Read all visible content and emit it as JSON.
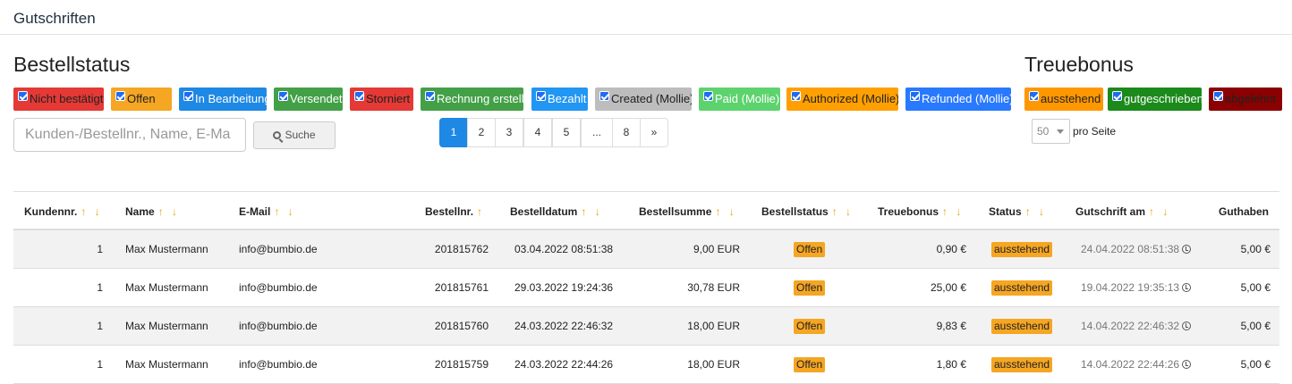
{
  "header": {
    "title": "Gutschriften"
  },
  "status_filter": {
    "heading": "Bestellstatus",
    "badges": [
      {
        "label": "Nicht bestätigt",
        "color": "#e53935",
        "text_color": "#222"
      },
      {
        "label": "Offen",
        "color": "#f5a623",
        "text_color": "#222"
      },
      {
        "label": "In Bearbeitung",
        "color": "#1e88e5",
        "text_color": "#fff"
      },
      {
        "label": "Versendet",
        "color": "#43a047",
        "text_color": "#fff"
      },
      {
        "label": "Storniert",
        "color": "#e53935",
        "text_color": "#222"
      },
      {
        "label": "Rechnung erstellt",
        "color": "#43a047",
        "text_color": "#fff"
      },
      {
        "label": "Bezahlt",
        "color": "#2196f3",
        "text_color": "#fff"
      },
      {
        "label": "Created (Mollie)",
        "color": "#bdbdbd",
        "text_color": "#222"
      },
      {
        "label": "Paid (Mollie)",
        "color": "#5cd36d",
        "text_color": "#fff"
      },
      {
        "label": "Authorized (Mollie)",
        "color": "#ffa000",
        "text_color": "#222"
      },
      {
        "label": "Refunded (Mollie)",
        "color": "#2979ff",
        "text_color": "#fff"
      }
    ]
  },
  "bonus_filter": {
    "heading": "Treuebonus",
    "badges": [
      {
        "label": "ausstehend",
        "color": "#ff9800",
        "text_color": "#222"
      },
      {
        "label": "gutgeschrieben",
        "color": "#1b8a1b",
        "text_color": "#fff"
      },
      {
        "label": "abgelehnt",
        "color": "#8b0000",
        "text_color": "#222"
      }
    ]
  },
  "search": {
    "placeholder": "Kunden-/Bestellnr., Name, E-Ma",
    "button_label": "Suche"
  },
  "pagination": [
    "1",
    "2",
    "3",
    "4",
    "5",
    "...",
    "8",
    "»"
  ],
  "per_page": {
    "value": "50",
    "label": "pro Seite"
  },
  "table": {
    "columns": [
      "Kundennr.",
      "Name",
      "E-Mail",
      "Bestellnr.",
      "Bestelldatum",
      "Bestellsumme",
      "Bestellstatus",
      "Treuebonus",
      "Status",
      "Gutschrift am",
      "Guthaben"
    ],
    "sort_arrows": [
      "↑ ↓",
      "↑ ↓",
      "↑ ↓",
      "↑",
      "↑ ↓",
      "↑ ↓",
      "↑ ↓",
      "↑ ↓",
      "↑ ↓",
      "↑ ↓",
      ""
    ],
    "rows": [
      [
        "1",
        "Max Mustermann",
        "info@bumbio.de",
        "201815762",
        "03.04.2022 08:51:38",
        "9,00 EUR",
        "Offen",
        "0,90 €",
        "ausstehend",
        "24.04.2022 08:51:38",
        "5,00 €"
      ],
      [
        "1",
        "Max Mustermann",
        "info@bumbio.de",
        "201815761",
        "29.03.2022 19:24:36",
        "30,78 EUR",
        "Offen",
        "25,00 €",
        "ausstehend",
        "19.04.2022 19:35:13",
        "5,00 €"
      ],
      [
        "1",
        "Max Mustermann",
        "info@bumbio.de",
        "201815760",
        "24.03.2022 22:46:32",
        "18,00 EUR",
        "Offen",
        "9,83 €",
        "ausstehend",
        "14.04.2022 22:46:32",
        "5,00 €"
      ],
      [
        "1",
        "Max Mustermann",
        "info@bumbio.de",
        "201815759",
        "24.03.2022 22:44:26",
        "18,00 EUR",
        "Offen",
        "1,80 €",
        "ausstehend",
        "14.04.2022 22:44:26",
        "5,00 €"
      ]
    ]
  }
}
